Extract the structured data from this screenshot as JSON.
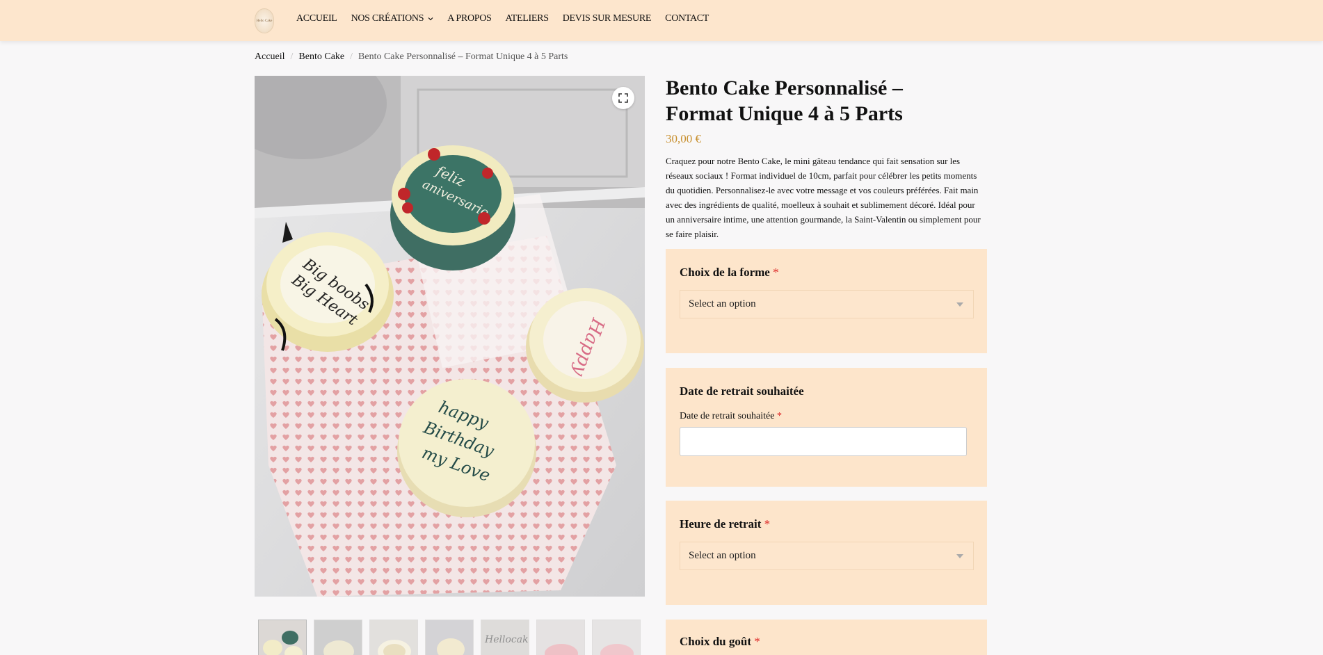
{
  "header": {
    "logo_text": "Hello Cake",
    "nav": [
      {
        "label": "ACCUEIL"
      },
      {
        "label": "NOS CRÉATIONS"
      },
      {
        "label": "A PROPOS"
      },
      {
        "label": "ATELIERS"
      },
      {
        "label": "DEVIS SUR MESURE"
      },
      {
        "label": "CONTACT"
      }
    ]
  },
  "breadcrumb": {
    "home": "Accueil",
    "category": "Bento Cake",
    "current": "Bento Cake Personnalisé – Format Unique 4 à 5 Parts"
  },
  "product": {
    "title": "Bento Cake Personnalisé – Format Unique 4 à 5 Parts",
    "price": "30,00 €",
    "description": "Craquez pour notre Bento Cake, le mini gâteau tendance qui fait sensation sur les réseaux sociaux ! Format individuel de 10cm, parfait pour célébrer les petits moments du quotidien. Personnalisez-le avec votre message et vos couleurs préférées. Fait main avec des ingrédients de qualité, moelleux à souhait et sublimement décoré. Idéal pour un anniversaire intime, une attention gourmande, la Saint-Valentin ou simplement pour se faire plaisir."
  },
  "options": {
    "forme": {
      "label": "Choix de la forme",
      "required": "*",
      "value": "Select an option"
    },
    "date": {
      "label": "Date de retrait souhaitée",
      "field_label": "Date de retrait souhaitée",
      "required": "*",
      "value": ""
    },
    "heure": {
      "label": "Heure de retrait",
      "required": "*",
      "value": "Select an option"
    },
    "gout": {
      "label": "Choix du goût",
      "required": "*"
    }
  },
  "colors": {
    "header_bg": "#fde6cd",
    "option_box_bg": "#fde5cb",
    "price": "#c8902f",
    "required": "#d22222"
  }
}
